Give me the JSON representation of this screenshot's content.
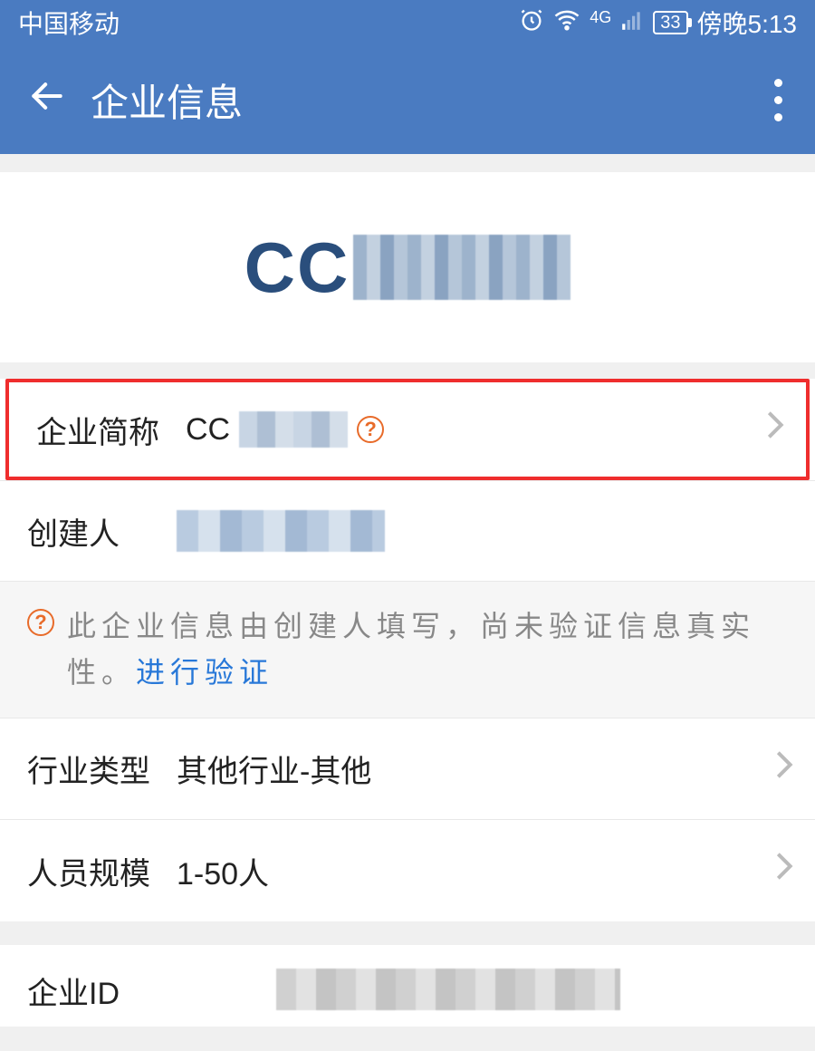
{
  "status": {
    "carrier": "中国移动",
    "battery": "33",
    "time": "傍晚5:13",
    "network": "4G"
  },
  "header": {
    "title": "企业信息"
  },
  "logo": {
    "prefix": "CC"
  },
  "rows": {
    "shortname_label": "企业简称",
    "shortname_value": "CC",
    "creator_label": "创建人",
    "industry_label": "行业类型",
    "industry_value": "其他行业-其他",
    "scale_label": "人员规模",
    "scale_value": "1-50人",
    "id_label": "企业ID"
  },
  "notice": {
    "text": "此企业信息由创建人填写，尚未验证信息真实性。",
    "link": "进行验证"
  }
}
